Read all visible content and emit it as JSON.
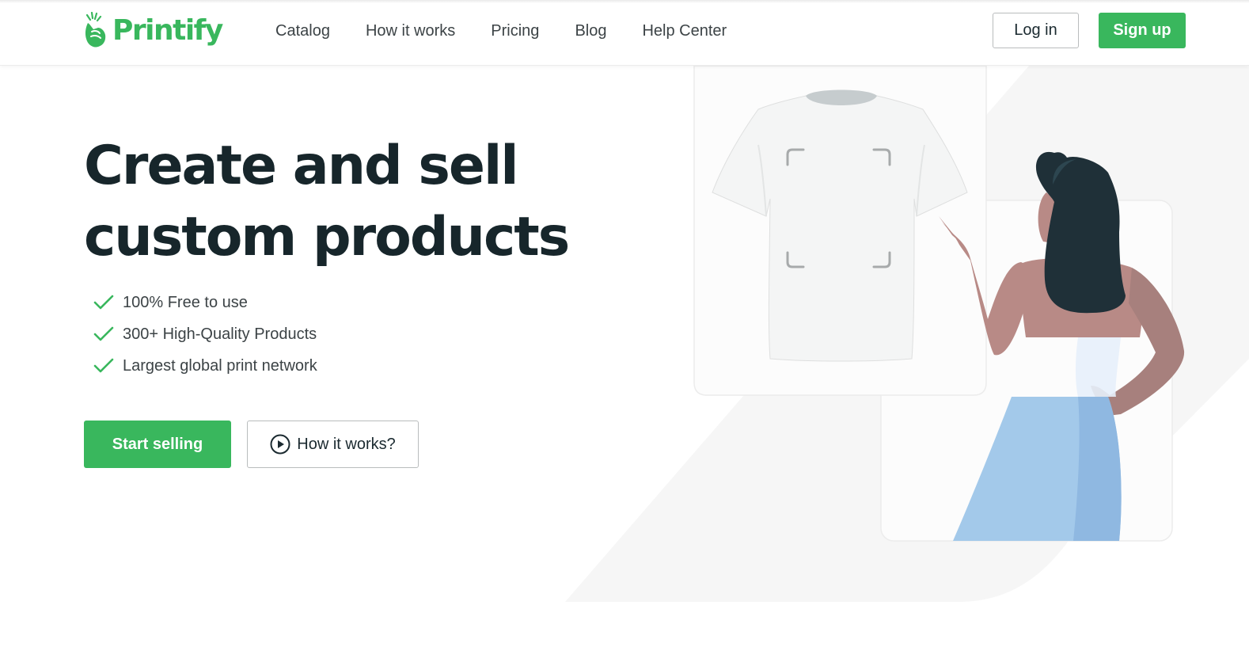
{
  "header": {
    "brand": "Printify",
    "nav": [
      "Catalog",
      "How it works",
      "Pricing",
      "Blog",
      "Help Center"
    ],
    "login_label": "Log in",
    "signup_label": "Sign up"
  },
  "hero": {
    "title": "Create and sell custom products",
    "features": [
      "100% Free to use",
      "300+ High-Quality Products",
      "Largest global print network"
    ],
    "start_label": "Start selling",
    "how_label": "How it works?"
  },
  "colors": {
    "brand_green": "#39b75d",
    "heading": "#17262b",
    "skirt_blue": "#a3c9ea"
  },
  "icons": {
    "logo": "printify-hand-logo-icon",
    "feature": "check-icon",
    "how": "play-circle-icon"
  }
}
